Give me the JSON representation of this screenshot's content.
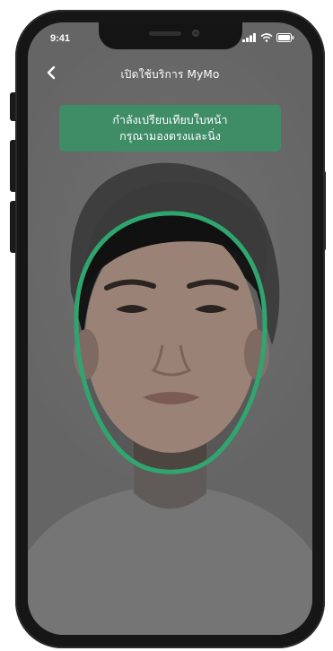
{
  "status_bar": {
    "time": "9:41",
    "icons": [
      "cellular-signal-icon",
      "wifi-icon",
      "battery-icon"
    ]
  },
  "nav": {
    "back_icon": "chevron-left-icon",
    "title": "เปิดใช้บริการ MyMo"
  },
  "instruction": {
    "line1": "กำลังเปรียบเทียบใบหน้า",
    "line2": "กรุณามองตรงและนิ่ง"
  },
  "colors": {
    "accent_green": "#3f8d67",
    "face_guide_stroke": "#2fa56f",
    "dim_overlay": "#808080"
  },
  "face_guide": {
    "shape": "oval",
    "visible": true
  }
}
